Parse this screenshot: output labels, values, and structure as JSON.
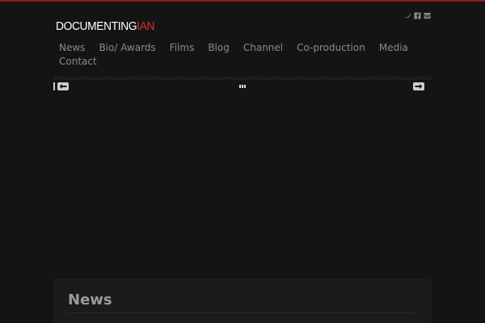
{
  "brand": {
    "logo_part1": "DOCUMENTING",
    "logo_part2": "IAN",
    "accent_color": "#d0342c",
    "top_bar_color": "#8b1a1a"
  },
  "social": [
    {
      "icon": "twitter-icon"
    },
    {
      "icon": "facebook-icon"
    },
    {
      "icon": "youtube-icon"
    }
  ],
  "nav": {
    "items": [
      "News",
      "Bio/ Awards",
      "Films",
      "Blog",
      "Channel",
      "Co-production",
      "Media",
      "Contact"
    ]
  },
  "slider": {
    "prev_icon": "arrow-left-icon",
    "next_icon": "arrow-right-icon",
    "pager_dots": 3
  },
  "news": {
    "title": "News"
  },
  "colors": {
    "background": "#141414",
    "nav_text": "#8a8a8a",
    "panel_bg": "#1b1b1b"
  }
}
